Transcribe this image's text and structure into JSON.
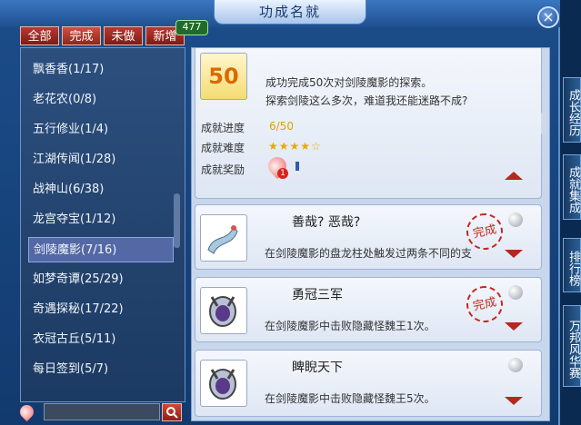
{
  "window": {
    "title": "功成名就",
    "close_label": "×"
  },
  "tabs": [
    {
      "label": "全部"
    },
    {
      "label": "完成"
    },
    {
      "label": "未做"
    },
    {
      "label": "新增"
    }
  ],
  "new_count": "477",
  "categories": [
    {
      "label": "飘香香(1/17)"
    },
    {
      "label": "老花农(0/8)"
    },
    {
      "label": "五行修业(1/4)"
    },
    {
      "label": "江湖传闻(1/28)"
    },
    {
      "label": "战神山(6/38)"
    },
    {
      "label": "龙宫夺宝(1/12)"
    },
    {
      "label": "剑陵魔影(7/16)"
    },
    {
      "label": "如梦奇谭(25/29)"
    },
    {
      "label": "奇遇探秘(17/22)"
    },
    {
      "label": "衣冠古丘(5/11)"
    },
    {
      "label": "每日签到(5/7)"
    }
  ],
  "search": {
    "placeholder": ""
  },
  "detail_card": {
    "icon_text": "50",
    "desc_line1": "成功完成50次对剑陵魔影的探索。",
    "desc_line2": "探索剑陵这么多次，难道我还能迷路不成?",
    "progress_label": "成就进度",
    "progress_value": "6/50",
    "difficulty_label": "成就难度",
    "difficulty_stars": "★★★★☆",
    "reward_label": "成就奖励",
    "reward_count": "1"
  },
  "achievements": [
    {
      "name": "善哉? 恶哉?",
      "desc": "在剑陵魔影的盘龙柱处触发过两条不同的支",
      "seal": "完成"
    },
    {
      "name": "勇冠三军",
      "desc": "在剑陵魔影中击败隐藏怪魏王1次。",
      "seal": "完成"
    },
    {
      "name": "睥睨天下",
      "desc": "在剑陵魔影中击败隐藏怪魏王5次。",
      "seal": ""
    }
  ],
  "side_tabs": [
    {
      "label": "成长经历"
    },
    {
      "label": "成就集成"
    },
    {
      "label": "排行榜"
    },
    {
      "label": "万邦风华赛"
    }
  ],
  "colors": {
    "accent_red": "#b8271e",
    "panel_blue": "#1c4d8a",
    "star_gold": "#e8a800"
  }
}
